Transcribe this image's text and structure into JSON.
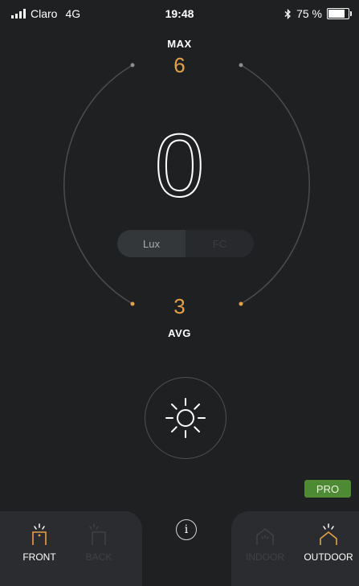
{
  "status_bar": {
    "carrier": "Claro",
    "network": "4G",
    "time": "19:48",
    "bluetooth_icon": "bluetooth-icon",
    "battery_percent": "75 %",
    "battery_level": 0.75
  },
  "meter": {
    "max_label": "MAX",
    "max_value": "6",
    "reading": "0",
    "avg_value": "3",
    "avg_label": "AVG"
  },
  "unit_toggle": {
    "options": [
      "Lux",
      "FC"
    ],
    "selected": "Lux"
  },
  "light_button": {
    "icon": "sun-icon"
  },
  "pro_badge": "PRO",
  "bottom_bar": {
    "front_label": "FRONT",
    "back_label": "BACK",
    "info_icon": "info-icon",
    "indoor_label": "INDOOR",
    "outdoor_label": "OUTDOOR",
    "selected_camera": "FRONT",
    "selected_environment": "OUTDOOR"
  },
  "colors": {
    "background": "#1f2022",
    "accent": "#e3a24a",
    "pro_green": "#4e8a34",
    "panel": "#2a2c2f"
  }
}
